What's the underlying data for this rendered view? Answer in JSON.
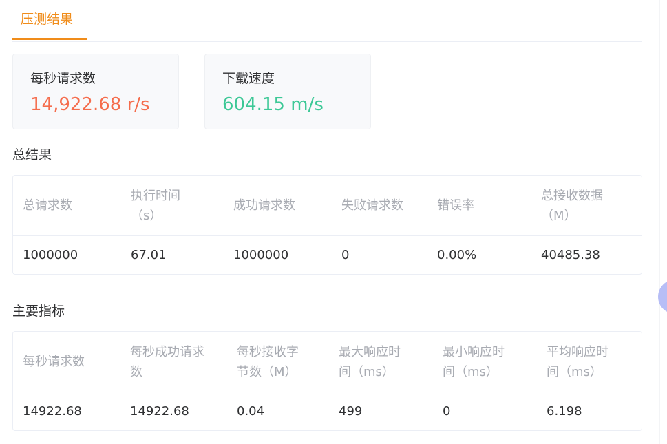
{
  "tabs": {
    "active_label": "压测结果"
  },
  "stats": {
    "rps_label": "每秒请求数",
    "rps_value": "14,922.68 r/s",
    "rps_color": "#f56c4c",
    "download_label": "下载速度",
    "download_value": "604.15 m/s",
    "download_color": "#3cc896"
  },
  "total_results": {
    "title": "总结果",
    "columns": [
      [
        "总请求数"
      ],
      [
        "执行时间",
        "（s）"
      ],
      [
        "成功请求数"
      ],
      [
        "失败请求数"
      ],
      [
        "错误率"
      ],
      [
        "总接收数据",
        "（M）"
      ]
    ],
    "rows": [
      [
        "1000000",
        "67.01",
        "1000000",
        "0",
        "0.00%",
        "40485.38"
      ]
    ]
  },
  "main_metrics": {
    "title": "主要指标",
    "columns": [
      [
        "每秒请求数"
      ],
      [
        "每秒成功请求",
        "数"
      ],
      [
        "每秒接收字",
        "节数（M）"
      ],
      [
        "最大响应时",
        "间（ms）"
      ],
      [
        "最小响应时",
        "间（ms）"
      ],
      [
        "平均响应时",
        "间（ms）"
      ]
    ],
    "rows": [
      [
        "14922.68",
        "14922.68",
        "0.04",
        "499",
        "0",
        "6.198"
      ]
    ]
  }
}
